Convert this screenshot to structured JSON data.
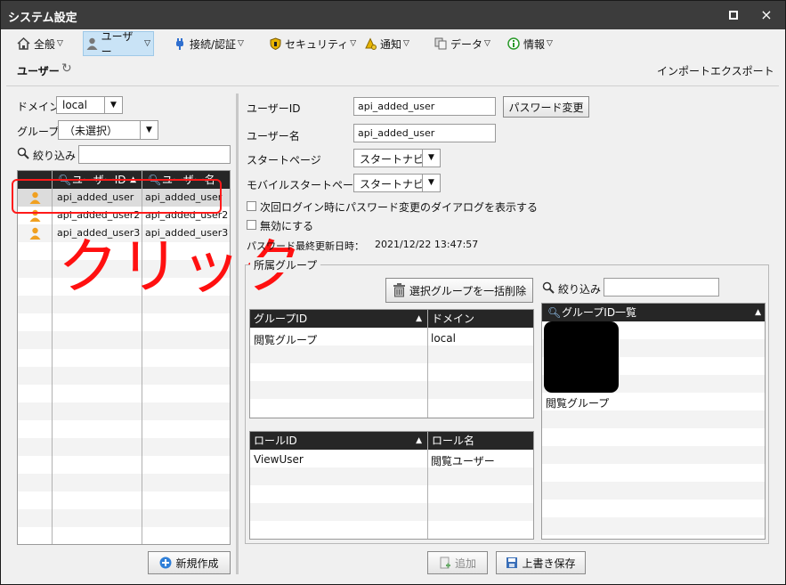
{
  "window": {
    "title": "システム設定",
    "maximize": "maximize",
    "close": "×"
  },
  "tabs": [
    {
      "label": "全般",
      "icon": "home-icon"
    },
    {
      "label": "ユーザー",
      "icon": "user-icon",
      "active": true
    },
    {
      "label": "接続/認証",
      "icon": "plug-icon"
    },
    {
      "label": "セキュリティ",
      "icon": "shield-icon"
    },
    {
      "label": "通知",
      "icon": "bell-icon"
    },
    {
      "label": "データ",
      "icon": "copy-icon"
    },
    {
      "label": "情報",
      "icon": "info-icon"
    }
  ],
  "subbar": {
    "title": "ユーザー",
    "import": "インポート",
    "export": "エクスポート"
  },
  "left": {
    "domain_label": "ドメイン",
    "domain_value": "local",
    "group_label": "グループ",
    "group_value": "（未選択）",
    "filter_label": "絞り込み",
    "filter_value": "",
    "columns": [
      "ユーザーID",
      "ユーザー名"
    ],
    "sort_marker": "▲",
    "users": [
      {
        "id": "api_added_user",
        "name": "api_added_user"
      },
      {
        "id": "api_added_user2",
        "name": "api_added_user2"
      },
      {
        "id": "api_added_user3",
        "name": "api_added_user3"
      }
    ],
    "new_button": "新規作成"
  },
  "annotation": {
    "text": "クリック",
    "color": "#ff1010"
  },
  "form": {
    "user_id_label": "ユーザーID",
    "user_id_value": "api_added_user",
    "password_button": "パスワード変更",
    "user_name_label": "ユーザー名",
    "user_name_value": "api_added_user",
    "start_page_label": "スタートページ",
    "start_page_value": "スタートナビ",
    "mobile_start_label": "モバイルスタートページ",
    "mobile_start_value": "スタートナビ",
    "check_password_dialog": "次回ログイン時にパスワード変更のダイアログを表示する",
    "check_disable": "無効にする",
    "pw_updated_label": "パスワード最終更新日時：",
    "pw_updated_value": "2021/12/22 13:47:57"
  },
  "groups": {
    "legend": "所属グループ",
    "bulk_delete": "選択グループを一括削除",
    "group_columns": [
      "グループID",
      "ドメイン"
    ],
    "group_rows": [
      {
        "id": "閲覧グループ",
        "domain": "local"
      }
    ],
    "role_columns": [
      "ロールID",
      "ロール名"
    ],
    "role_rows": [
      {
        "id": "ViewUser",
        "name": "閲覧ユーザー"
      }
    ],
    "filter_label": "絞り込み",
    "filter_value": "",
    "list_header": "グループID一覧",
    "list_items": [
      "閲覧グループ"
    ]
  },
  "footer": {
    "add": "追加",
    "save": "上書き保存"
  },
  "colors": {
    "header_bg": "#262626",
    "active_tab": "#c9e3f6",
    "accent": "#ff1a1a"
  }
}
